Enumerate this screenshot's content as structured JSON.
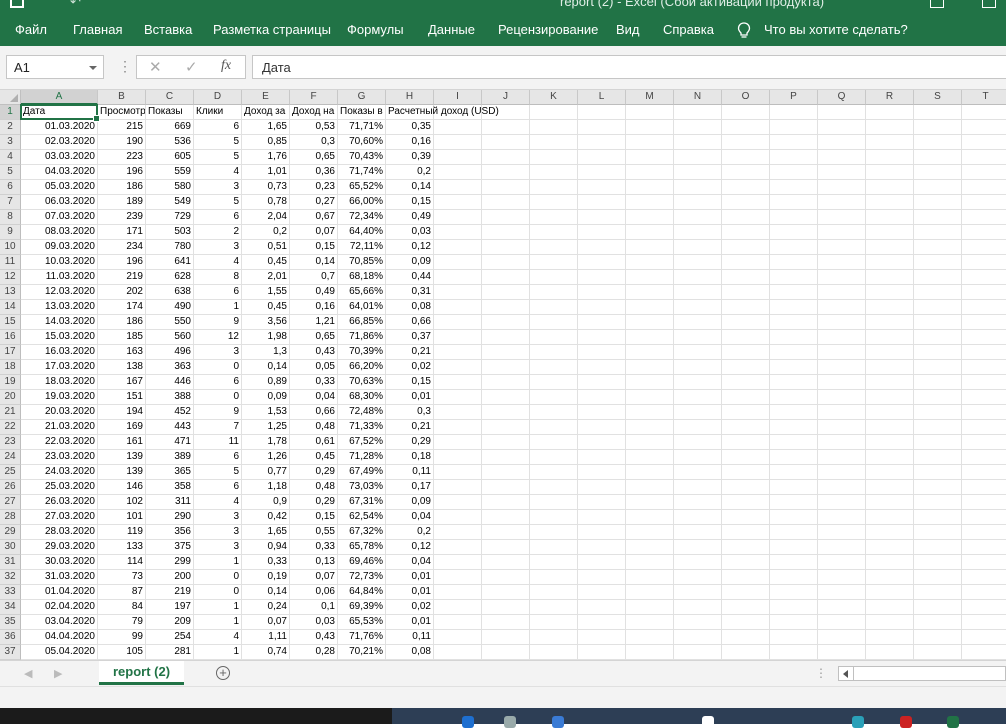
{
  "window": {
    "title": "report (2) - Excel (Сбой активации продукта)"
  },
  "ribbon": {
    "tabs": [
      "Файл",
      "Главная",
      "Вставка",
      "Разметка страницы",
      "Формулы",
      "Данные",
      "Рецензирование",
      "Вид",
      "Справка"
    ],
    "tell_me": "Что вы хотите сделать?"
  },
  "formula_bar": {
    "name_box": "A1",
    "content": "Дата",
    "fx_label": "fx"
  },
  "sheet": {
    "columns": [
      "A",
      "B",
      "C",
      "D",
      "E",
      "F",
      "G",
      "H",
      "I",
      "J",
      "K",
      "L",
      "M",
      "N",
      "O",
      "P",
      "Q",
      "R",
      "S",
      "T"
    ],
    "headers": [
      "Дата",
      "Просмотр",
      "Показы",
      "Клики",
      "Доход за",
      "Доход на",
      "Показы в",
      "Расчетный доход (USD)"
    ],
    "rows": [
      [
        "01.03.2020",
        "215",
        "669",
        "6",
        "1,65",
        "0,53",
        "71,71%",
        "0,35"
      ],
      [
        "02.03.2020",
        "190",
        "536",
        "5",
        "0,85",
        "0,3",
        "70,60%",
        "0,16"
      ],
      [
        "03.03.2020",
        "223",
        "605",
        "5",
        "1,76",
        "0,65",
        "70,43%",
        "0,39"
      ],
      [
        "04.03.2020",
        "196",
        "559",
        "4",
        "1,01",
        "0,36",
        "71,74%",
        "0,2"
      ],
      [
        "05.03.2020",
        "186",
        "580",
        "3",
        "0,73",
        "0,23",
        "65,52%",
        "0,14"
      ],
      [
        "06.03.2020",
        "189",
        "549",
        "5",
        "0,78",
        "0,27",
        "66,00%",
        "0,15"
      ],
      [
        "07.03.2020",
        "239",
        "729",
        "6",
        "2,04",
        "0,67",
        "72,34%",
        "0,49"
      ],
      [
        "08.03.2020",
        "171",
        "503",
        "2",
        "0,2",
        "0,07",
        "64,40%",
        "0,03"
      ],
      [
        "09.03.2020",
        "234",
        "780",
        "3",
        "0,51",
        "0,15",
        "72,11%",
        "0,12"
      ],
      [
        "10.03.2020",
        "196",
        "641",
        "4",
        "0,45",
        "0,14",
        "70,85%",
        "0,09"
      ],
      [
        "11.03.2020",
        "219",
        "628",
        "8",
        "2,01",
        "0,7",
        "68,18%",
        "0,44"
      ],
      [
        "12.03.2020",
        "202",
        "638",
        "6",
        "1,55",
        "0,49",
        "65,66%",
        "0,31"
      ],
      [
        "13.03.2020",
        "174",
        "490",
        "1",
        "0,45",
        "0,16",
        "64,01%",
        "0,08"
      ],
      [
        "14.03.2020",
        "186",
        "550",
        "9",
        "3,56",
        "1,21",
        "66,85%",
        "0,66"
      ],
      [
        "15.03.2020",
        "185",
        "560",
        "12",
        "1,98",
        "0,65",
        "71,86%",
        "0,37"
      ],
      [
        "16.03.2020",
        "163",
        "496",
        "3",
        "1,3",
        "0,43",
        "70,39%",
        "0,21"
      ],
      [
        "17.03.2020",
        "138",
        "363",
        "0",
        "0,14",
        "0,05",
        "66,20%",
        "0,02"
      ],
      [
        "18.03.2020",
        "167",
        "446",
        "6",
        "0,89",
        "0,33",
        "70,63%",
        "0,15"
      ],
      [
        "19.03.2020",
        "151",
        "388",
        "0",
        "0,09",
        "0,04",
        "68,30%",
        "0,01"
      ],
      [
        "20.03.2020",
        "194",
        "452",
        "9",
        "1,53",
        "0,66",
        "72,48%",
        "0,3"
      ],
      [
        "21.03.2020",
        "169",
        "443",
        "7",
        "1,25",
        "0,48",
        "71,33%",
        "0,21"
      ],
      [
        "22.03.2020",
        "161",
        "471",
        "11",
        "1,78",
        "0,61",
        "67,52%",
        "0,29"
      ],
      [
        "23.03.2020",
        "139",
        "389",
        "6",
        "1,26",
        "0,45",
        "71,28%",
        "0,18"
      ],
      [
        "24.03.2020",
        "139",
        "365",
        "5",
        "0,77",
        "0,29",
        "67,49%",
        "0,11"
      ],
      [
        "25.03.2020",
        "146",
        "358",
        "6",
        "1,18",
        "0,48",
        "73,03%",
        "0,17"
      ],
      [
        "26.03.2020",
        "102",
        "311",
        "4",
        "0,9",
        "0,29",
        "67,31%",
        "0,09"
      ],
      [
        "27.03.2020",
        "101",
        "290",
        "3",
        "0,42",
        "0,15",
        "62,54%",
        "0,04"
      ],
      [
        "28.03.2020",
        "119",
        "356",
        "3",
        "1,65",
        "0,55",
        "67,32%",
        "0,2"
      ],
      [
        "29.03.2020",
        "133",
        "375",
        "3",
        "0,94",
        "0,33",
        "65,78%",
        "0,12"
      ],
      [
        "30.03.2020",
        "114",
        "299",
        "1",
        "0,33",
        "0,13",
        "69,46%",
        "0,04"
      ],
      [
        "31.03.2020",
        "73",
        "200",
        "0",
        "0,19",
        "0,07",
        "72,73%",
        "0,01"
      ],
      [
        "01.04.2020",
        "87",
        "219",
        "0",
        "0,14",
        "0,06",
        "64,84%",
        "0,01"
      ],
      [
        "02.04.2020",
        "84",
        "197",
        "1",
        "0,24",
        "0,1",
        "69,39%",
        "0,02"
      ],
      [
        "03.04.2020",
        "79",
        "209",
        "1",
        "0,07",
        "0,03",
        "65,53%",
        "0,01"
      ],
      [
        "04.04.2020",
        "99",
        "254",
        "4",
        "1,11",
        "0,43",
        "71,76%",
        "0,11"
      ],
      [
        "05.04.2020",
        "105",
        "281",
        "1",
        "0,74",
        "0,28",
        "70,21%",
        "0,08"
      ]
    ]
  },
  "sheet_tabs": {
    "active": "report (2)"
  }
}
